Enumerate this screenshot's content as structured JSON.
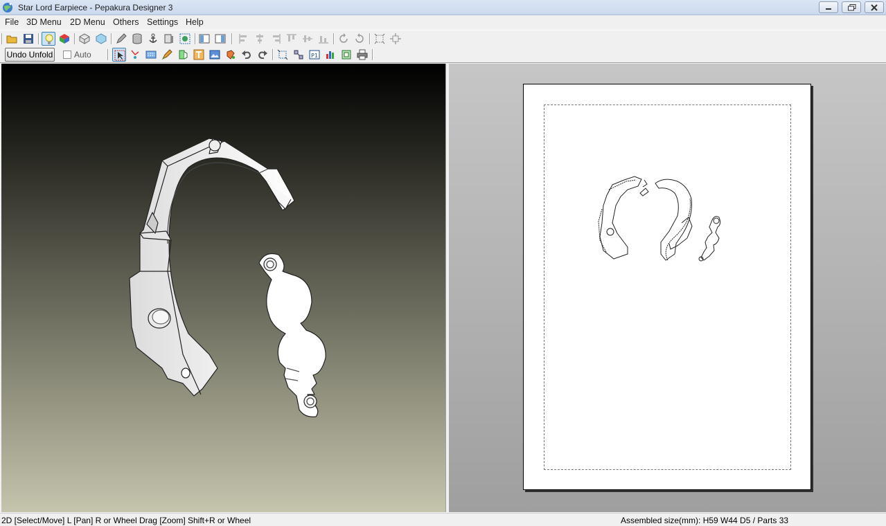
{
  "window": {
    "title": "Star Lord Earpiece - Pepakura Designer 3",
    "app_icon": "pepakura-globe-icon"
  },
  "menubar": {
    "items": [
      "File",
      "3D Menu",
      "2D Menu",
      "Others",
      "Settings",
      "Help"
    ]
  },
  "toolbar2": {
    "undo_unfold_label": "Undo Unfold",
    "auto_label": "Auto",
    "auto_checked": false
  },
  "statusbar": {
    "left": "2D [Select/Move] L [Pan] R or Wheel Drag [Zoom] Shift+R or Wheel",
    "right": "Assembled size(mm): H59 W44 D5 / Parts 33"
  },
  "colors": {
    "title_gradient": "#c9d9ee",
    "active_button": "#cbe4f5",
    "viewport_top": "#000000",
    "viewport_bottom": "#c5c4ad"
  }
}
